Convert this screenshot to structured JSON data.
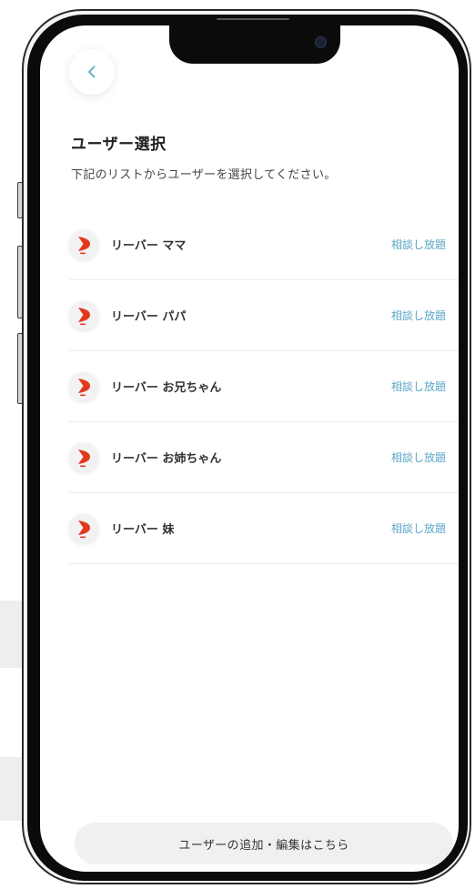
{
  "header": {
    "back_icon": "chevron-left-icon"
  },
  "page": {
    "title": "ユーザー選択",
    "subtitle": "下記のリストからユーザーを選択してください。"
  },
  "users": [
    {
      "name": "リーバー ママ",
      "plan": "相談し放題"
    },
    {
      "name": "リーバー パパ",
      "plan": "相談し放題"
    },
    {
      "name": "リーバー お兄ちゃん",
      "plan": "相談し放題"
    },
    {
      "name": "リーバー お姉ちゃん",
      "plan": "相談し放題"
    },
    {
      "name": "リーバー 妹",
      "plan": "相談し放題"
    }
  ],
  "footer": {
    "add_edit_label": "ユーザーの追加・編集はこちら"
  },
  "colors": {
    "accent": "#5aa6c8",
    "logo": "#e03a1e"
  }
}
